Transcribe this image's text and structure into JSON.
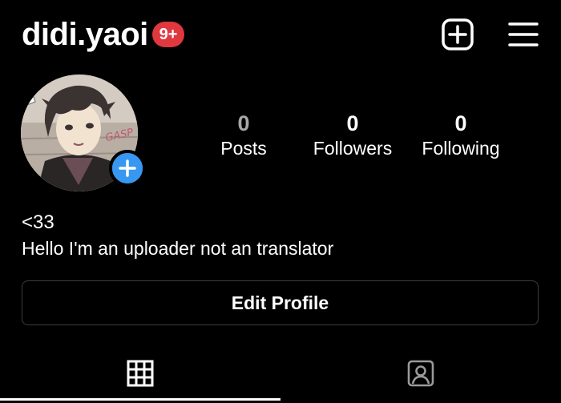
{
  "header": {
    "username": "didi.yaoi",
    "notification_badge": "9+",
    "badge_color": "#e0383f",
    "create_icon": "plus-square-icon",
    "menu_icon": "hamburger-menu-icon"
  },
  "profile": {
    "avatar_add_color": "#3897f0",
    "avatar_add_icon": "plus-icon",
    "stats": {
      "posts": {
        "value": "0",
        "label": "Posts"
      },
      "followers": {
        "value": "0",
        "label": "Followers"
      },
      "following": {
        "value": "0",
        "label": "Following"
      }
    },
    "name": "<33",
    "bio": "Hello I'm an uploader not an translator",
    "edit_button": "Edit Profile"
  },
  "avatar_art": {
    "caption": "GASP"
  },
  "tabs": [
    {
      "icon": "grid-icon",
      "selected": true
    },
    {
      "icon": "tagged-user-icon",
      "selected": false
    }
  ]
}
